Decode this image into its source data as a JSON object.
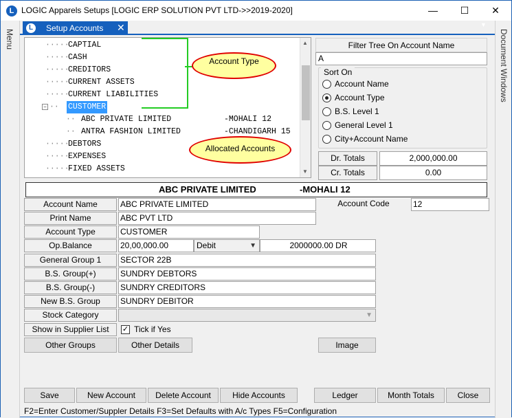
{
  "window": {
    "title": "LOGIC Apparels Setups  [LOGIC ERP SOLUTION PVT LTD->>2019-2020]",
    "app_icon": "L"
  },
  "controls": {
    "minimize": "—",
    "maximize": "☐",
    "close": "✕"
  },
  "rails": {
    "left": "Menu",
    "right": "Document Windows"
  },
  "tab": {
    "label": "Setup Accounts",
    "close": "✕"
  },
  "tree": {
    "rows": [
      {
        "text": "CAPTIAL"
      },
      {
        "text": "CASH"
      },
      {
        "text": "CREDITORS"
      },
      {
        "text": "CURRENT ASSETS"
      },
      {
        "text": "CURRENT LIABILITIES"
      },
      {
        "text": "CUSTOMER",
        "selected": true
      },
      {
        "text": "ABC PRIVATE LIMITED",
        "suffix": "-MOHALI 12",
        "child": true
      },
      {
        "text": "ANTRA FASHION LIMITED",
        "suffix": "-CHANDIGARH 15",
        "child": true
      },
      {
        "text": "DEBTORS"
      },
      {
        "text": "EXPENSES"
      },
      {
        "text": "FIXED ASSETS"
      }
    ],
    "annotations": {
      "type": "Account  Type",
      "allocated": "Allocated  Accounts"
    }
  },
  "filter": {
    "title": "Filter Tree On Account Name",
    "value": "A"
  },
  "sort": {
    "legend": "Sort On",
    "options": [
      {
        "label": "Account Name",
        "selected": false
      },
      {
        "label": "Account Type",
        "selected": true
      },
      {
        "label": "B.S. Level 1",
        "selected": false
      },
      {
        "label": "General Level 1",
        "selected": false
      },
      {
        "label": "City+Account Name",
        "selected": false
      }
    ]
  },
  "totals": {
    "dr_label": "Dr. Totals",
    "dr_value": "2,000,000.00",
    "cr_label": "Cr. Totals",
    "cr_value": "0.00"
  },
  "header": {
    "name": "ABC PRIVATE LIMITED",
    "city": "-MOHALI 12"
  },
  "form": {
    "account_name_label": "Account Name",
    "account_name": "ABC PRIVATE LIMITED",
    "account_code_label": "Account Code",
    "account_code": "12",
    "print_name_label": "Print Name",
    "print_name": "ABC PVT LTD",
    "account_type_label": "Account Type",
    "account_type": "CUSTOMER",
    "op_balance_label": "Op.Balance",
    "op_balance": "20,00,000.00",
    "drcr": "Debit",
    "balance_text": "2000000.00 DR",
    "general_group_label": "General Group 1",
    "general_group": "SECTOR 22B",
    "bs_plus_label": "B.S. Group(+)",
    "bs_plus": "SUNDRY DEBTORS",
    "bs_minus_label": "B.S. Group(-)",
    "bs_minus": "SUNDRY CREDITORS",
    "new_bs_label": "New B.S. Group",
    "new_bs": "SUNDRY DEBITOR",
    "stock_category_label": "Stock Category",
    "stock_category": "",
    "supplier_label": "Show in Supplier List",
    "tick_label": "Tick if Yes",
    "tick": "✓"
  },
  "buttons": {
    "other_groups": "Other Groups",
    "other_details": "Other Details",
    "image": "Image",
    "save": "Save",
    "new_account": "New Account",
    "delete_account": "Delete Account",
    "hide_accounts": "Hide Accounts",
    "ledger": "Ledger",
    "month_totals": "Month Totals",
    "close": "Close"
  },
  "status": "F2=Enter Customer/Suppler Details   F3=Set Defaults with A/c Types   F5=Configuration"
}
